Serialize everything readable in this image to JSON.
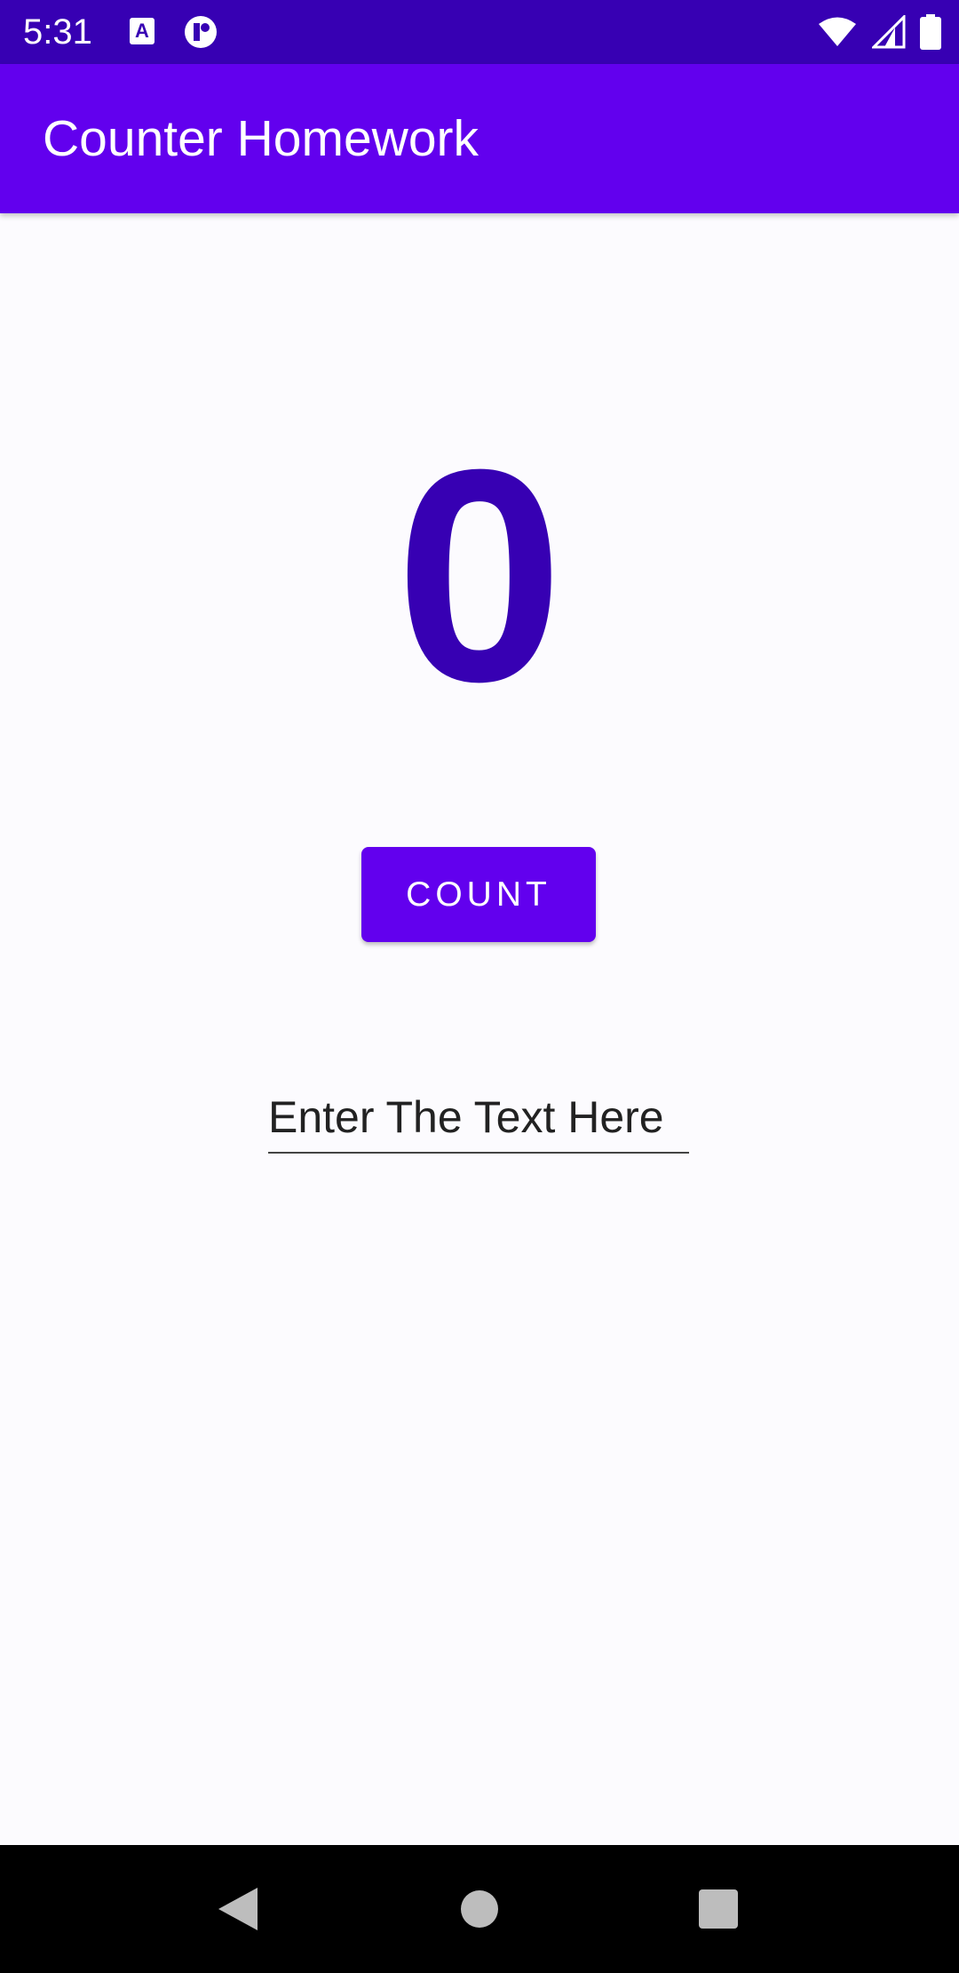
{
  "status_bar": {
    "time": "5:31",
    "notification_icons": [
      "text-a-icon",
      "app-notification-icon"
    ],
    "system_icons": [
      "wifi-icon",
      "signal-icon",
      "battery-icon"
    ],
    "notification_letter": "A"
  },
  "app_bar": {
    "title": "Counter Homework"
  },
  "main": {
    "counter_value": "0",
    "count_button_label": "COUNT",
    "input": {
      "placeholder": "Enter The Text Here",
      "value": ""
    }
  },
  "nav_bar": {
    "icons": [
      "back-icon",
      "home-icon",
      "recents-icon"
    ]
  },
  "colors": {
    "status_bar": "#3700b3",
    "app_bar": "#6200ee",
    "counter_text": "#3700b3",
    "button": "#6200ee",
    "background": "#fcfbfe"
  }
}
